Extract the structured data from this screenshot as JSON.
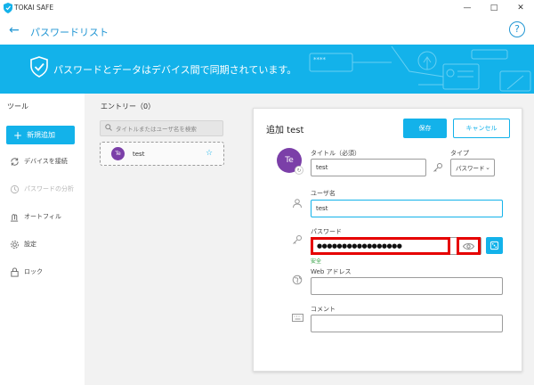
{
  "window": {
    "app_title": "TOKAI SAFE"
  },
  "header": {
    "title": "パスワードリスト",
    "help": "?"
  },
  "banner": {
    "text": "パスワードとデータはデバイス間で同期されています。",
    "deco_text": "****"
  },
  "sidebar": {
    "heading": "ツール",
    "new_button": "新規追加",
    "items": [
      {
        "label": "デバイスを接続",
        "icon": "sync-icon",
        "enabled": true
      },
      {
        "label": "パスワードの分析",
        "icon": "analysis-icon",
        "enabled": false
      },
      {
        "label": "オートフィル",
        "icon": "autofill-icon",
        "enabled": true
      },
      {
        "label": "設定",
        "icon": "gear-icon",
        "enabled": true
      },
      {
        "label": "ロック",
        "icon": "lock-icon",
        "enabled": true
      }
    ]
  },
  "entries": {
    "heading": "エントリー（0）",
    "search_placeholder": "タイトルまたはユーザ名を検索",
    "items": [
      {
        "initials": "Te",
        "name": "test",
        "starred": true
      }
    ]
  },
  "detail": {
    "title": "追加 test",
    "save_label": "保存",
    "cancel_label": "キャンセル",
    "avatar_initials": "Te",
    "title_label": "タイトル（必須）",
    "title_value": "test",
    "type_label": "タイプ",
    "type_value": "パスワード",
    "username_label": "ユーザ名",
    "username_value": "test",
    "password_label": "パスワード",
    "password_value": "●●●●●●●●●●●●●●●●●",
    "password_strength": "安全",
    "web_label": "Web アドレス",
    "web_value": "",
    "comment_label": "コメント",
    "comment_value": ""
  },
  "colors": {
    "accent": "#13b2ea",
    "highlight": "#e60000",
    "avatar": "#7b3fa8",
    "safe": "#2e9e3e"
  }
}
